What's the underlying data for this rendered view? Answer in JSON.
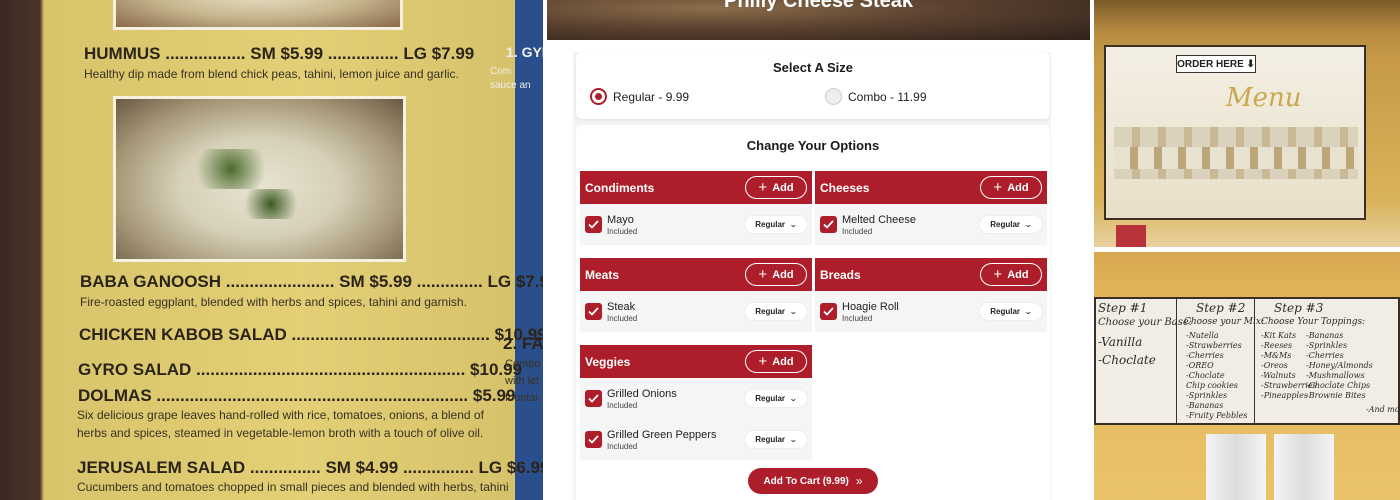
{
  "product": {
    "title": "Philly Cheese Steak"
  },
  "size_section": {
    "title": "Select A Size",
    "options": [
      {
        "label": "Regular - 9.99",
        "selected": true
      },
      {
        "label": "Combo - 11.99",
        "selected": false
      }
    ]
  },
  "options_section": {
    "title": "Change Your Options",
    "add_label": "Add",
    "groups": [
      {
        "name": "Condiments",
        "items": [
          {
            "name": "Mayo",
            "status": "Included",
            "portion": "Regular"
          }
        ]
      },
      {
        "name": "Cheeses",
        "items": [
          {
            "name": "Melted Cheese",
            "status": "Included",
            "portion": "Regular"
          }
        ]
      },
      {
        "name": "Meats",
        "items": [
          {
            "name": "Steak",
            "status": "Included",
            "portion": "Regular"
          }
        ]
      },
      {
        "name": "Breads",
        "items": [
          {
            "name": "Hoagie Roll",
            "status": "Included",
            "portion": "Regular"
          }
        ]
      },
      {
        "name": "Veggies",
        "items": [
          {
            "name": "Grilled Onions",
            "status": "Included",
            "portion": "Regular"
          },
          {
            "name": "Grilled Green Peppers",
            "status": "Included",
            "portion": "Regular"
          }
        ]
      }
    ]
  },
  "cart": {
    "label": "Add To Cart (9.99)"
  },
  "background": {
    "menu_board": {
      "items": [
        {
          "name": "HUMMUS",
          "dots": ".................",
          "sm": "SM $5.99",
          "dots2": "...............",
          "lg": "LG $7.99",
          "desc": "Healthy dip made from blend chick peas, tahini, lemon juice and garlic."
        },
        {
          "name": "BABA GANOOSH",
          "dots": ".......................",
          "sm": "SM $5.99",
          "dots2": "..............",
          "lg": "LG $7.99",
          "desc": "Fire-roasted eggplant, blended with herbs and spices, tahini and garnish."
        },
        {
          "name": "CHICKEN KABOB SALAD",
          "dots": "..........................................",
          "price": "$10.99"
        },
        {
          "name": "GYRO SALAD",
          "dots": ".........................................................",
          "price": "$10.99"
        },
        {
          "name": "DOLMAS",
          "dots": "..................................................................",
          "price": "$5.99",
          "desc": "Six delicious grape leaves hand-rolled with rice, tomatoes, onions, a blend of",
          "desc2": "herbs and spices, steamed in vegetable-lemon broth with a touch of olive oil."
        },
        {
          "name": "JERUSALEM SALAD",
          "dots": "...............",
          "sm": "SM $4.99",
          "dots2": "...............",
          "lg": "LG $6.99",
          "desc": "Cucumbers and tomatoes chopped in small pieces and blended with herbs, tahini"
        }
      ],
      "side_heading": "2. FAL",
      "side_text": [
        "Combo",
        "with let",
        "fountai"
      ],
      "top_snippet": "1. GYRO",
      "top_side_text": [
        "Com",
        "sauce an"
      ]
    },
    "order_sign": "ORDER HERE ⬇",
    "menu_script": "Menu",
    "whiteboard": {
      "steps": [
        "Step #1",
        "Step #2",
        "Step #3"
      ],
      "step1": [
        "Choose your Base:",
        "-Vanilla",
        "-Choclate"
      ],
      "step2": [
        "Choose your Mix:",
        "-Nutella",
        "-Strawberries",
        "-Cherries",
        "-OREO",
        "-Choclate",
        "Chip cookies",
        "-Sprinkles",
        "-Bananas",
        "-Fruity Pebbles"
      ],
      "step3": [
        "Choose Your Toppings:",
        "-Kit Kats",
        "-Reeses",
        "-M&Ms",
        "-Oreos",
        "-Walnuts",
        "-Strawberries",
        "-Pineapples",
        "-Bananas",
        "-Sprinkles",
        "-Cherries",
        "-Honey/Almonds",
        "-Mushmallows",
        "-Choclate Chips",
        "-Brownie Bites",
        "-And more"
      ]
    }
  },
  "colors": {
    "accent": "#ad1e2a",
    "card_bg": "#ffffff",
    "panel_bg": "#f4f4f4"
  },
  "icons": {
    "check": "check-icon",
    "plus": "plus-icon",
    "chevron": "chevron-down-icon",
    "double_chevron": "double-chevron-right-icon"
  }
}
